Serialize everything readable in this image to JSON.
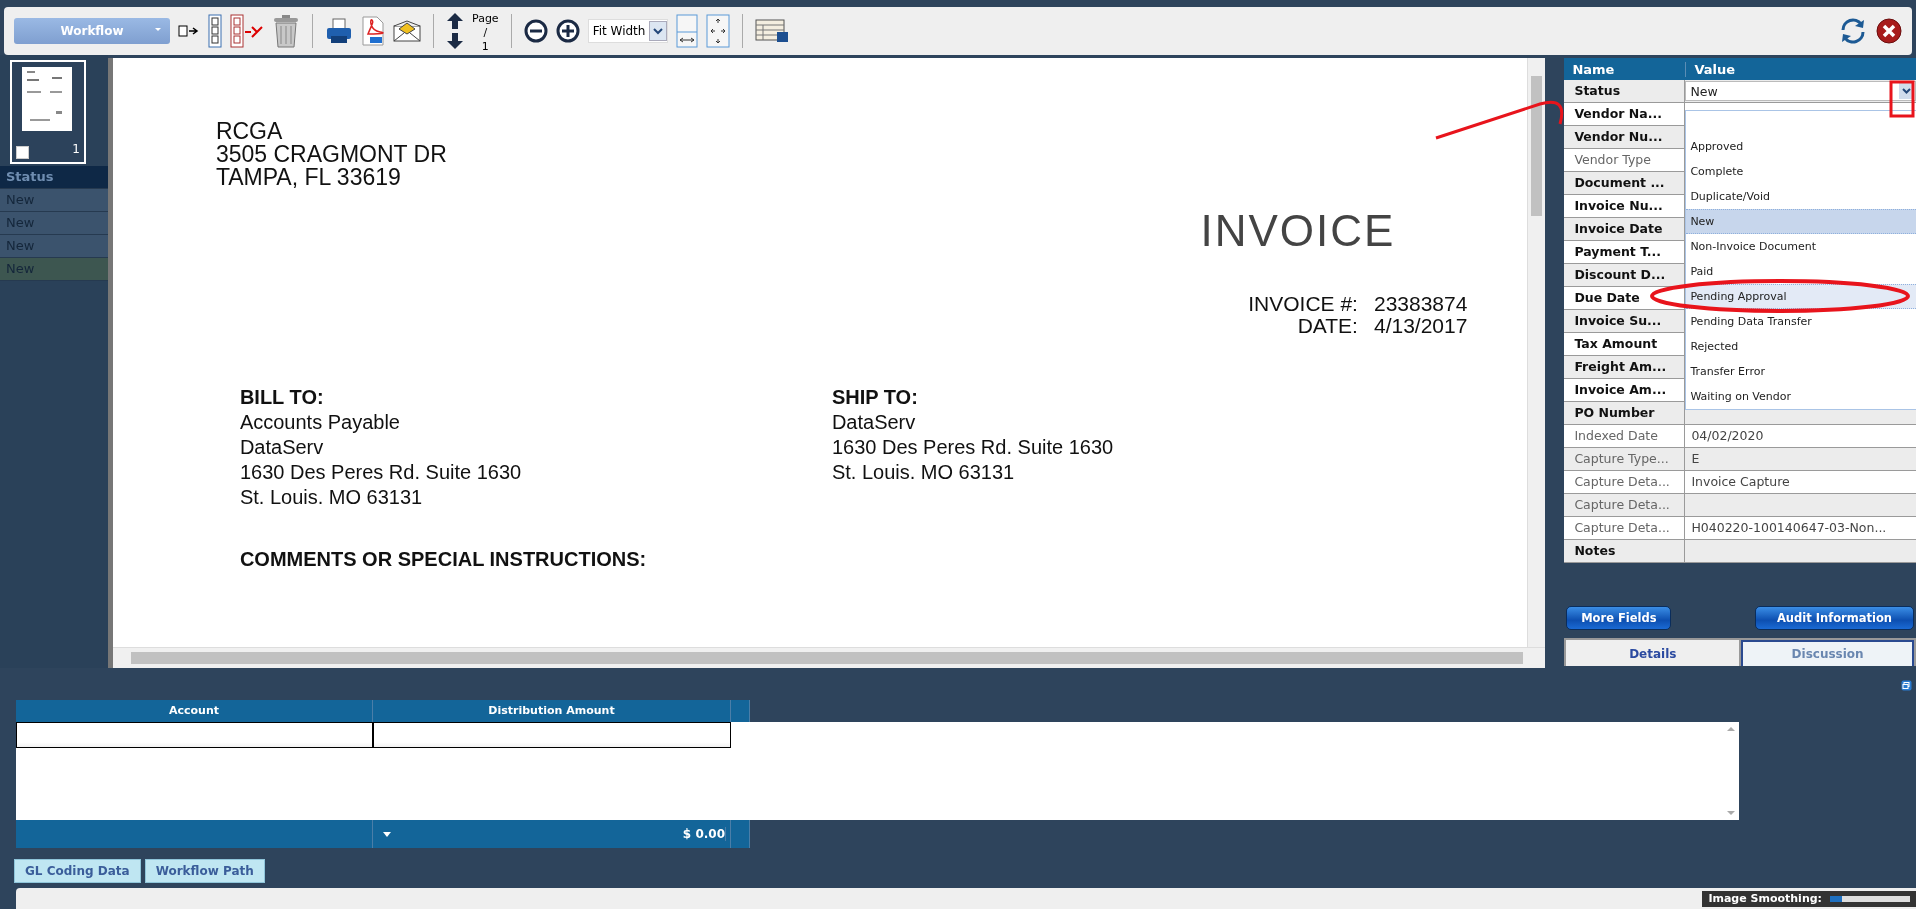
{
  "toolbar": {
    "workflow_button": "Workflow",
    "page_label": "Page",
    "page_number": "1",
    "page_separator": "/",
    "zoom_select": "Fit Width"
  },
  "thumbnails": [
    {
      "number": "1",
      "checked": false
    }
  ],
  "background_list": {
    "header": "Status",
    "rows": [
      "New",
      "New",
      "New",
      "New"
    ]
  },
  "document": {
    "sender": [
      "RCGA",
      "3505 CRAGMONT DR",
      "TAMPA, FL 33619"
    ],
    "title": "INVOICE",
    "meta": [
      {
        "label": "INVOICE #:",
        "value": "23383874"
      },
      {
        "label": "DATE:",
        "value": "4/13/2017"
      }
    ],
    "bill_to": {
      "heading": "BILL TO:",
      "lines": [
        "Accounts Payable",
        "DataServ",
        "1630 Des Peres Rd. Suite 1630",
        "St. Louis. MO 63131"
      ]
    },
    "ship_to": {
      "heading": "SHIP TO:",
      "lines": [
        "DataServ",
        "1630 Des Peres Rd. Suite 1630",
        "St. Louis. MO 63131"
      ]
    },
    "comments_heading": "COMMENTS OR SPECIAL INSTRUCTIONS:"
  },
  "fields": {
    "columns": [
      "Name",
      "Value"
    ],
    "rows": [
      {
        "name": "Status",
        "required": true,
        "value": "New"
      },
      {
        "name": "Vendor Na...",
        "required": true
      },
      {
        "name": "Vendor Nu...",
        "required": true
      },
      {
        "name": "Vendor Type",
        "required": false
      },
      {
        "name": "Document ...",
        "required": true
      },
      {
        "name": "Invoice Nu...",
        "required": true
      },
      {
        "name": "Invoice Date",
        "required": true
      },
      {
        "name": "Payment T...",
        "required": true
      },
      {
        "name": "Discount D...",
        "required": true
      },
      {
        "name": "Due Date",
        "required": true
      },
      {
        "name": "Invoice Su...",
        "required": true
      },
      {
        "name": "Tax Amount",
        "required": true
      },
      {
        "name": "Freight Am...",
        "required": true
      },
      {
        "name": "Invoice Am...",
        "required": true
      },
      {
        "name": "PO Number",
        "required": true,
        "value": ""
      },
      {
        "name": "Indexed Date",
        "required": false,
        "value": "04/02/2020"
      },
      {
        "name": "Capture Type...",
        "required": false,
        "value": "E"
      },
      {
        "name": "Capture Deta...",
        "required": false,
        "value": "Invoice Capture"
      },
      {
        "name": "Capture Deta...",
        "required": false,
        "value": ""
      },
      {
        "name": "Capture Deta...",
        "required": false,
        "value": "H040220-100140647-03-Non..."
      },
      {
        "name": "Notes",
        "required": true,
        "value": ""
      }
    ],
    "dropdown": [
      {
        "label": "Approved",
        "selected": false,
        "hovered": false
      },
      {
        "label": "Complete",
        "selected": false,
        "hovered": false
      },
      {
        "label": "Duplicate/Void",
        "selected": false,
        "hovered": false
      },
      {
        "label": "New",
        "selected": true,
        "hovered": false
      },
      {
        "label": "Non-Invoice Document",
        "selected": false,
        "hovered": false
      },
      {
        "label": "Paid",
        "selected": false,
        "hovered": false
      },
      {
        "label": "Pending Approval",
        "selected": false,
        "hovered": true
      },
      {
        "label": "Pending Data Transfer",
        "selected": false,
        "hovered": false
      },
      {
        "label": "Rejected",
        "selected": false,
        "hovered": false
      },
      {
        "label": "Transfer Error",
        "selected": false,
        "hovered": false
      },
      {
        "label": "Waiting on Vendor",
        "selected": false,
        "hovered": false
      }
    ],
    "buttons": [
      "More Fields",
      "Audit Information"
    ],
    "tabs": [
      {
        "label": "Details",
        "selected": true
      },
      {
        "label": "Discussion",
        "selected": false
      }
    ]
  },
  "gl_grid": {
    "columns": [
      "Account",
      "Distribution Amount"
    ],
    "total": "$ 0.00"
  },
  "bottom_tabs": [
    {
      "label": "GL Coding Data",
      "selected": false
    },
    {
      "label": "Workflow Path",
      "selected": false
    }
  ],
  "status_bar": {
    "image_smoothing_label": "Image Smoothing:",
    "level": 0.15
  }
}
